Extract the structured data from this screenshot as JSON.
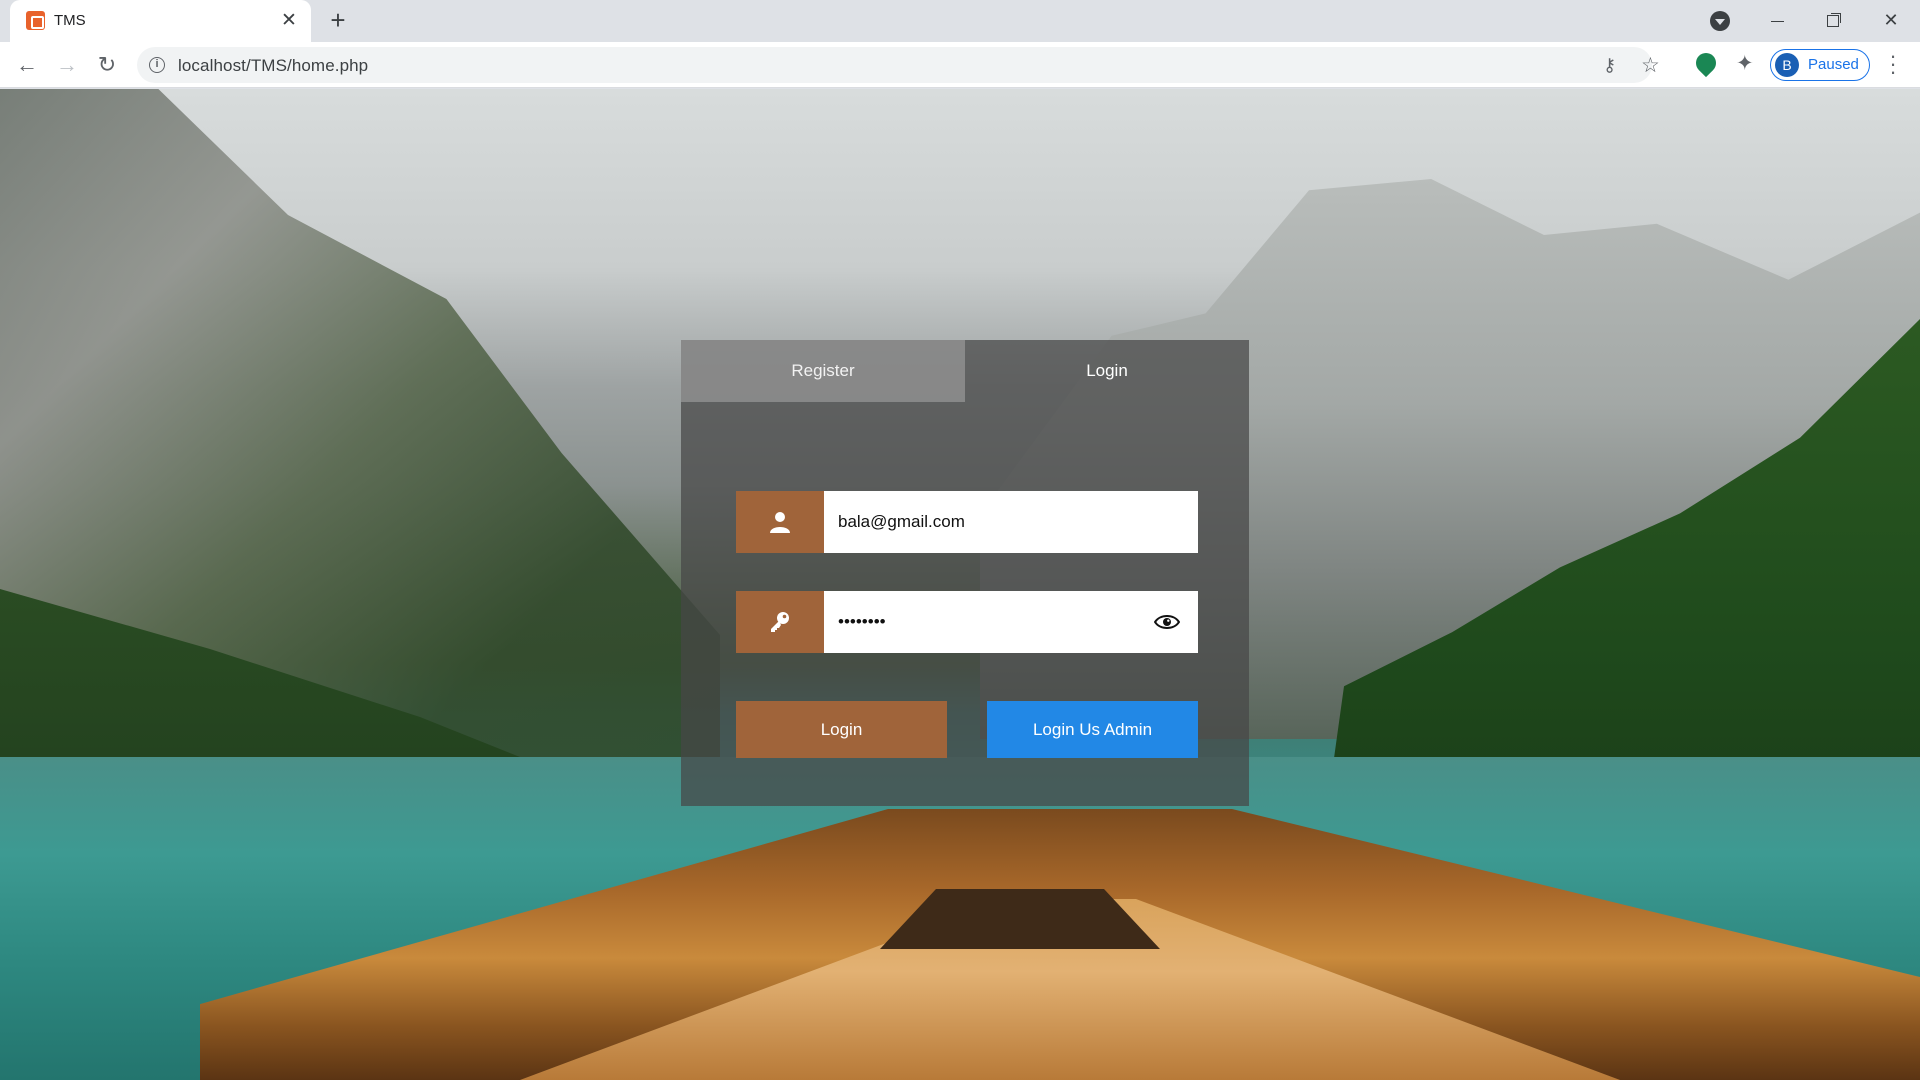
{
  "browser": {
    "tab_title": "TMS",
    "tab_close": "✕",
    "new_tab": "+",
    "url": "localhost/TMS/home.php",
    "profile_initial": "B",
    "profile_status": "Paused"
  },
  "form": {
    "tabs": [
      {
        "label": "Register",
        "active": false
      },
      {
        "label": "Login",
        "active": true
      }
    ],
    "email_value": "bala@gmail.com",
    "password_value": "••••••••",
    "login_button": "Login",
    "admin_button": "Login Us Admin"
  },
  "colors": {
    "accent_brown": "#a0643a",
    "admin_blue": "#2288e6",
    "panel_overlay": "rgba(70,70,70,0.72)"
  },
  "icons": {
    "email_field": "user-icon",
    "password_field": "key-icon",
    "password_toggle": "eye-icon"
  }
}
